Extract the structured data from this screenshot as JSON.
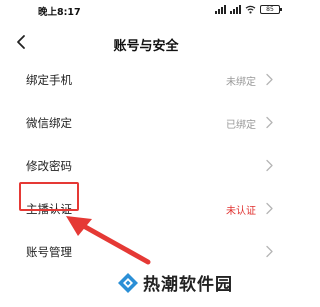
{
  "status_bar": {
    "time": "晚上8:17",
    "battery": "85"
  },
  "nav": {
    "title": "账号与安全"
  },
  "rows": [
    {
      "label": "绑定手机",
      "value": "未绑定"
    },
    {
      "label": "微信绑定",
      "value": "已绑定"
    },
    {
      "label": "修改密码",
      "value": ""
    },
    {
      "label": "主播认证",
      "value": "未认证"
    },
    {
      "label": "账号管理",
      "value": ""
    }
  ],
  "colors": {
    "alert": "#e0312f",
    "highlight": "#e53935",
    "muted": "#999999"
  },
  "watermark": {
    "text": "热潮软件园"
  }
}
